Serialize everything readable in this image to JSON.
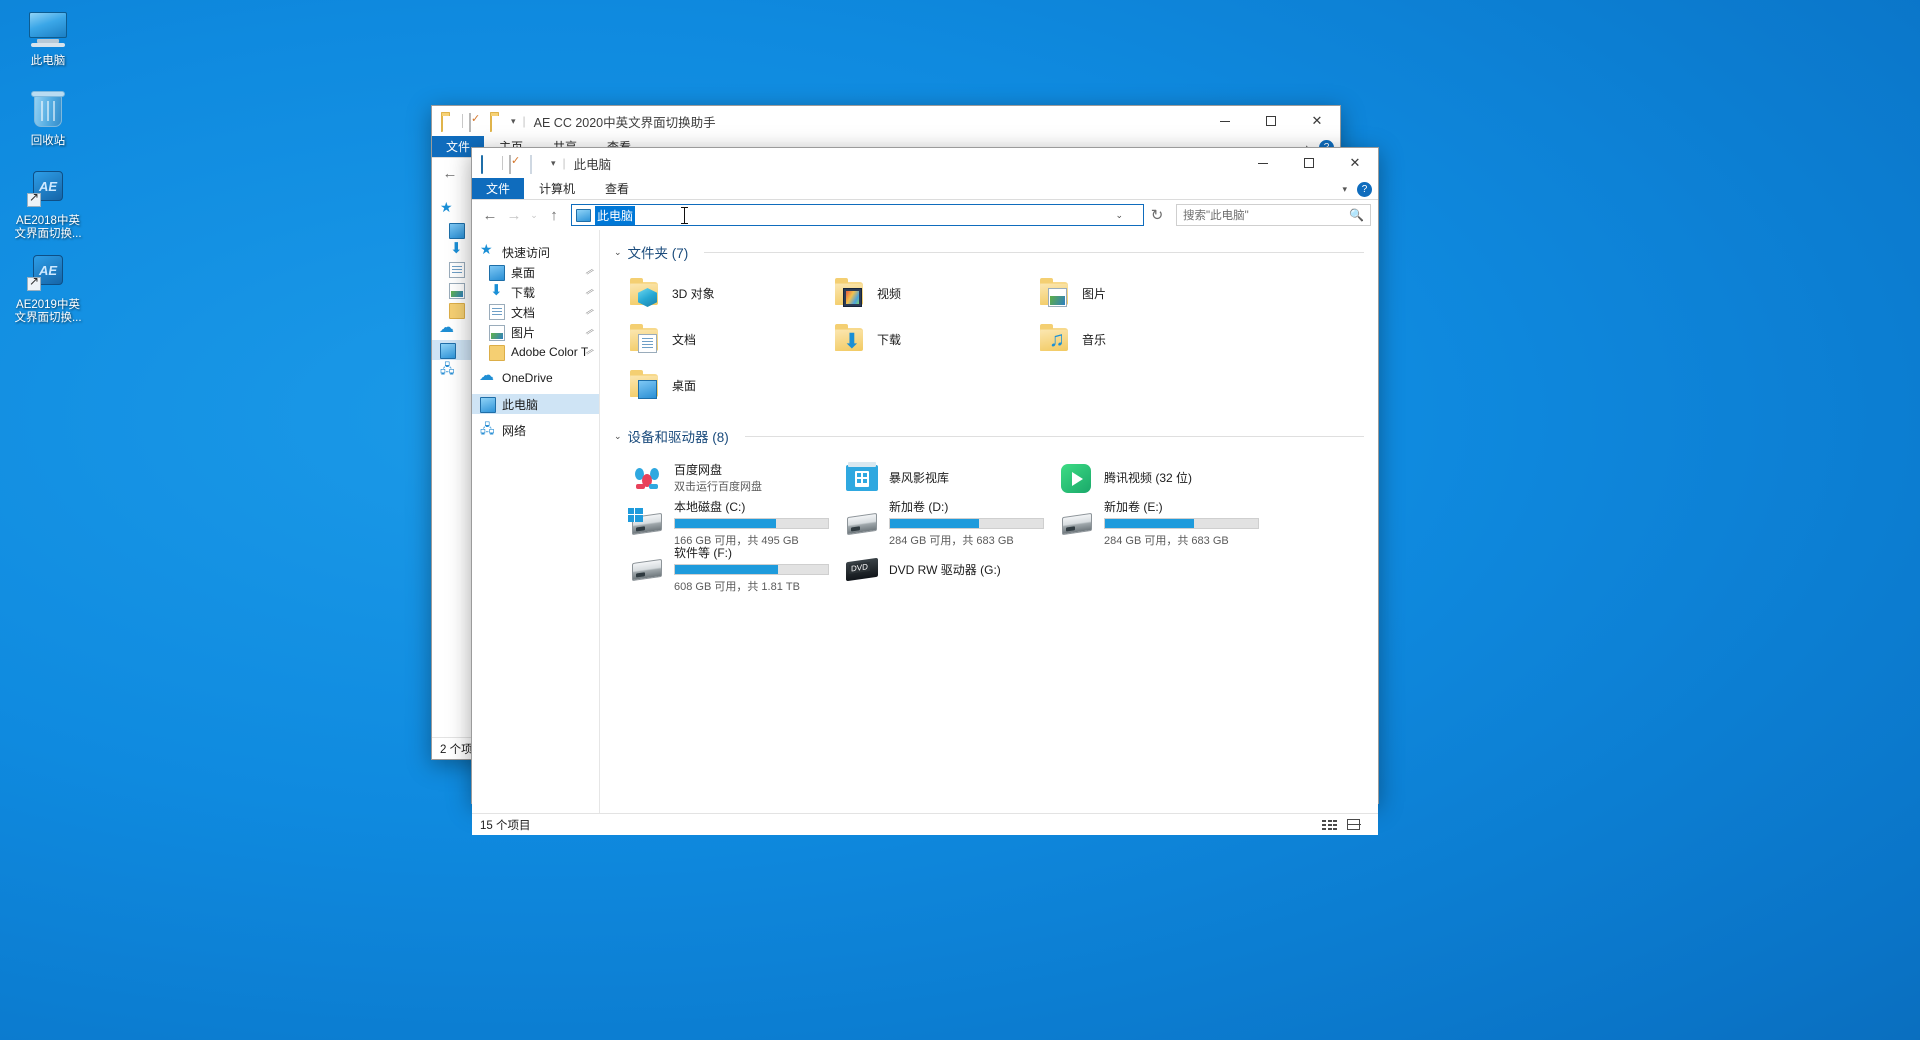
{
  "desktop": {
    "icons": [
      {
        "name": "此电脑",
        "icon": "this-pc-icon"
      },
      {
        "name": "回收站",
        "icon": "recycle-bin-icon"
      },
      {
        "name": "AE2018中英\n文界面切换...",
        "icon": "ae2018-shortcut-icon"
      },
      {
        "name": "AE2019中英\n文界面切换...",
        "icon": "ae2019-shortcut-icon"
      }
    ]
  },
  "background_window": {
    "title": "AE CC 2020中英文界面切换助手",
    "quick_access": [
      "folder-icon",
      "properties-icon",
      "new-folder-icon",
      "chevron-down-icon"
    ],
    "tabs": {
      "file": "文件",
      "items": [
        "主页",
        "共享",
        "查看"
      ]
    },
    "window_buttons": {
      "minimize": "─",
      "maximize": "□",
      "close": "✕"
    },
    "status": "2 个项",
    "help": "?"
  },
  "front_window": {
    "title": "此电脑",
    "quick_access": [
      "this-pc-icon",
      "properties-icon",
      "blank-icon",
      "chevron-down-icon"
    ],
    "tabs": {
      "file": "文件",
      "items": [
        "计算机",
        "查看"
      ]
    },
    "window_buttons": {
      "minimize": "─",
      "maximize": "□",
      "close": "✕"
    },
    "help": "?",
    "nav": {
      "back": "←",
      "forward": "→",
      "history": "⌄",
      "up": "↑",
      "address_value": "此电脑",
      "address_dropdown": "⌄",
      "refresh": "↻"
    },
    "search": {
      "placeholder": "搜索\"此电脑\"",
      "icon": "search-icon"
    },
    "sidebar": [
      {
        "label": "快速访问",
        "icon": "star-icon",
        "pin": "",
        "selected": false,
        "indent": false
      },
      {
        "label": "桌面",
        "icon": "desktop-icon",
        "pin": "⫽",
        "selected": false,
        "indent": true
      },
      {
        "label": "下载",
        "icon": "downloads-icon",
        "pin": "⫽",
        "selected": false,
        "indent": true
      },
      {
        "label": "文档",
        "icon": "documents-icon",
        "pin": "⫽",
        "selected": false,
        "indent": true
      },
      {
        "label": "图片",
        "icon": "pictures-icon",
        "pin": "⫽",
        "selected": false,
        "indent": true
      },
      {
        "label": "Adobe Color T",
        "icon": "folder-icon",
        "pin": "⫽",
        "selected": false,
        "indent": true
      },
      {
        "label": "OneDrive",
        "icon": "onedrive-cloud-icon",
        "pin": "",
        "selected": false,
        "indent": false
      },
      {
        "label": "此电脑",
        "icon": "this-pc-icon",
        "pin": "",
        "selected": true,
        "indent": false
      },
      {
        "label": "网络",
        "icon": "network-icon",
        "pin": "",
        "selected": false,
        "indent": false
      }
    ],
    "folders_group": {
      "title": "文件夹 (7)",
      "chevron": "⌄",
      "items": [
        {
          "label": "3D 对象",
          "icon": "3d-objects-folder-icon"
        },
        {
          "label": "视频",
          "icon": "videos-folder-icon"
        },
        {
          "label": "图片",
          "icon": "pictures-folder-icon"
        },
        {
          "label": "文档",
          "icon": "documents-folder-icon"
        },
        {
          "label": "下载",
          "icon": "downloads-folder-icon"
        },
        {
          "label": "音乐",
          "icon": "music-folder-icon"
        },
        {
          "label": "桌面",
          "icon": "desktop-folder-icon"
        }
      ]
    },
    "drives_group": {
      "title": "设备和驱动器 (8)",
      "chevron": "⌄",
      "items": [
        {
          "label": "百度网盘",
          "sub": "双击运行百度网盘",
          "icon": "baidu-netdisk-icon",
          "bar": null
        },
        {
          "label": "暴风影视库",
          "sub": "",
          "icon": "baofeng-library-icon",
          "bar": null
        },
        {
          "label": "腾讯视频 (32 位)",
          "sub": "",
          "icon": "tencent-video-icon",
          "bar": null
        },
        {
          "label": "本地磁盘 (C:)",
          "sub": "166 GB 可用，共 495 GB",
          "icon": "local-disk-icon",
          "bar": 66
        },
        {
          "label": "新加卷 (D:)",
          "sub": "284 GB 可用，共 683 GB",
          "icon": "hdd-icon",
          "bar": 58
        },
        {
          "label": "新加卷 (E:)",
          "sub": "284 GB 可用，共 683 GB",
          "icon": "hdd-icon",
          "bar": 58
        },
        {
          "label": "软件等 (F:)",
          "sub": "608 GB 可用，共 1.81 TB",
          "icon": "hdd-icon",
          "bar": 67
        },
        {
          "label": "DVD RW 驱动器 (G:)",
          "sub": "",
          "icon": "dvd-drive-icon",
          "bar": null
        }
      ]
    },
    "status": "15 个项目",
    "view_buttons": [
      "details-view-icon",
      "large-icons-view-icon"
    ]
  }
}
